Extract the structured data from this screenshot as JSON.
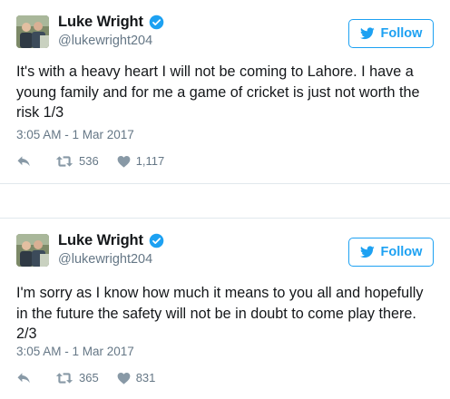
{
  "tweets": [
    {
      "name": "Luke Wright",
      "handle": "@lukewright204",
      "follow_label": "Follow",
      "text": "It's with a heavy heart I will not be coming to Lahore. I have a young family and for me a game of cricket is just not worth the risk 1/3",
      "timestamp": "3:05 AM - 1 Mar 2017",
      "retweets": "536",
      "likes": "1,117"
    },
    {
      "name": "Luke Wright",
      "handle": "@lukewright204",
      "follow_label": "Follow",
      "text": "I'm sorry as I know how much it means to you all and hopefully in the future the safety will not be in doubt to come play there. 2/3",
      "timestamp": "3:05 AM - 1 Mar 2017",
      "retweets": "365",
      "likes": "831"
    }
  ],
  "colors": {
    "accent": "#1da1f2",
    "muted": "#657786",
    "text": "#14171a"
  },
  "icons": [
    "avatar-photo",
    "verified-badge-icon",
    "twitter-bird-icon",
    "reply-icon",
    "retweet-icon",
    "heart-icon"
  ]
}
